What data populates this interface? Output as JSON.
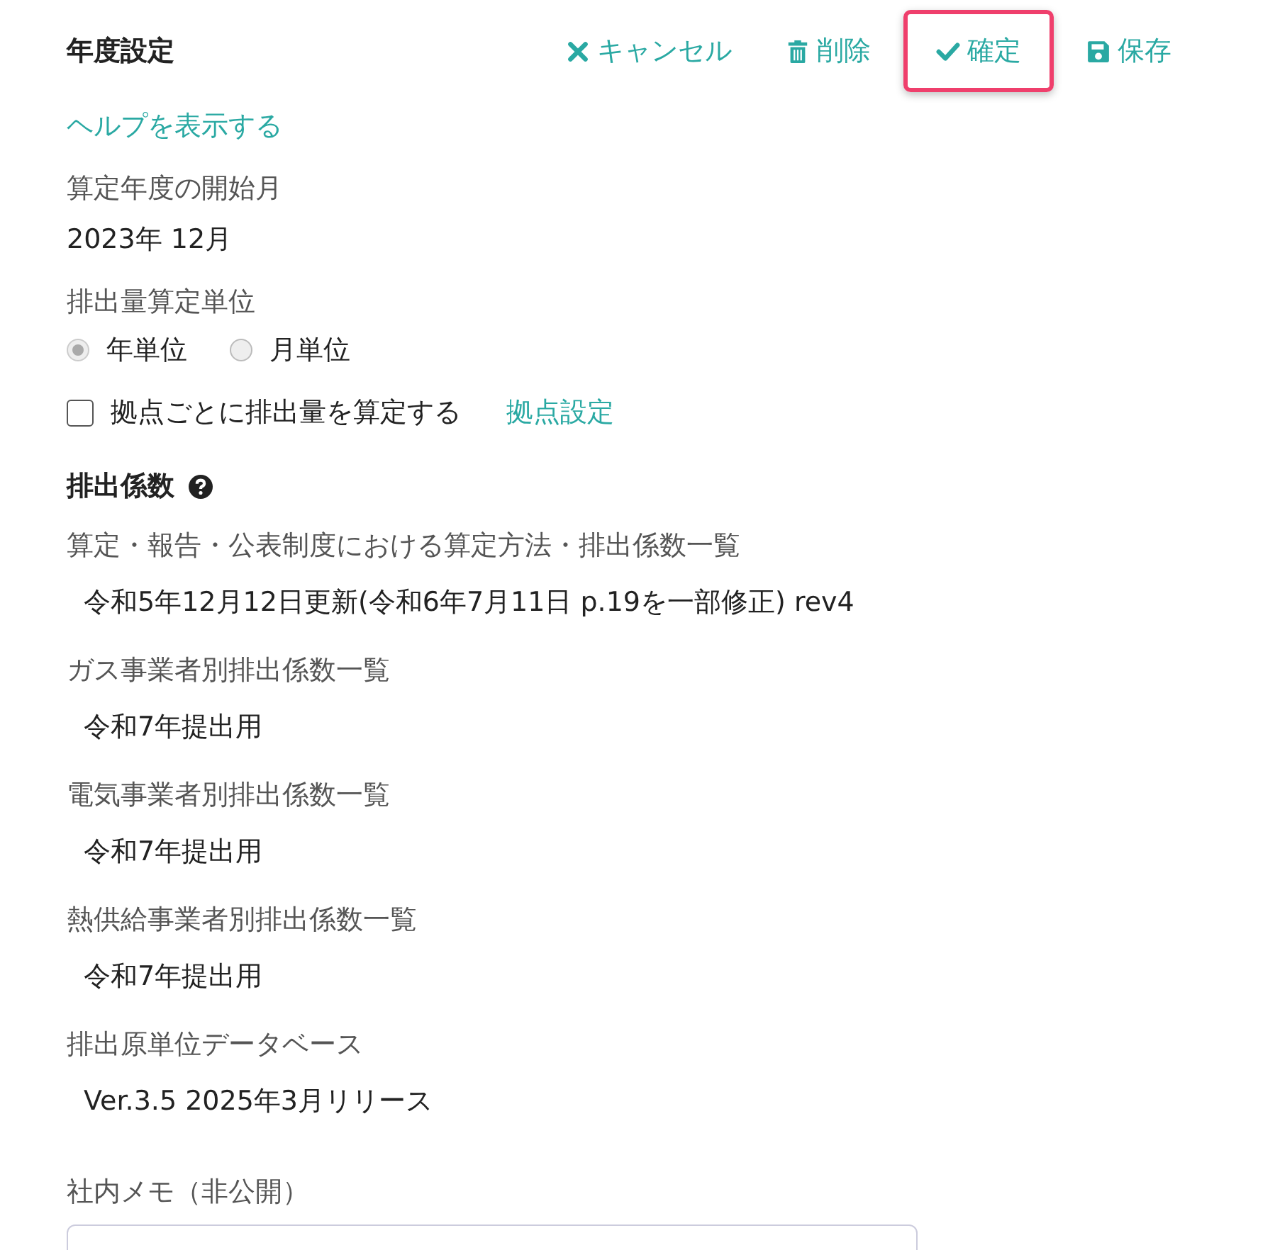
{
  "header": {
    "title": "年度設定",
    "actions": [
      {
        "kind": "cancel",
        "label": "キャンセル",
        "highlighted": false
      },
      {
        "kind": "delete",
        "label": "削除",
        "highlighted": false
      },
      {
        "kind": "confirm",
        "label": "確定",
        "highlighted": true
      },
      {
        "kind": "save",
        "label": "保存",
        "highlighted": false
      }
    ]
  },
  "help_link": "ヘルプを表示する",
  "start_month": {
    "label": "算定年度の開始月",
    "value": "2023年 12月"
  },
  "unit": {
    "label": "排出量算定単位",
    "options": [
      {
        "label": "年単位",
        "selected": true,
        "disabled": true
      },
      {
        "label": "月単位",
        "selected": false,
        "disabled": true
      }
    ]
  },
  "per_site": {
    "label": "拠点ごとに排出量を算定する",
    "checked": false,
    "link": "拠点設定"
  },
  "coefficients": {
    "title": "排出係数",
    "items": [
      {
        "label": "算定・報告・公表制度における算定方法・排出係数一覧",
        "value": "令和5年12月12日更新(令和6年7月11日 p.19を一部修正) rev4"
      },
      {
        "label": "ガス事業者別排出係数一覧",
        "value": "令和7年提出用"
      },
      {
        "label": "電気事業者別排出係数一覧",
        "value": "令和7年提出用"
      },
      {
        "label": "熱供給事業者別排出係数一覧",
        "value": "令和7年提出用"
      },
      {
        "label": "排出原単位データベース",
        "value": "Ver.3.5 2025年3月リリース"
      }
    ]
  },
  "memo": {
    "label": "社内メモ（非公開）"
  }
}
